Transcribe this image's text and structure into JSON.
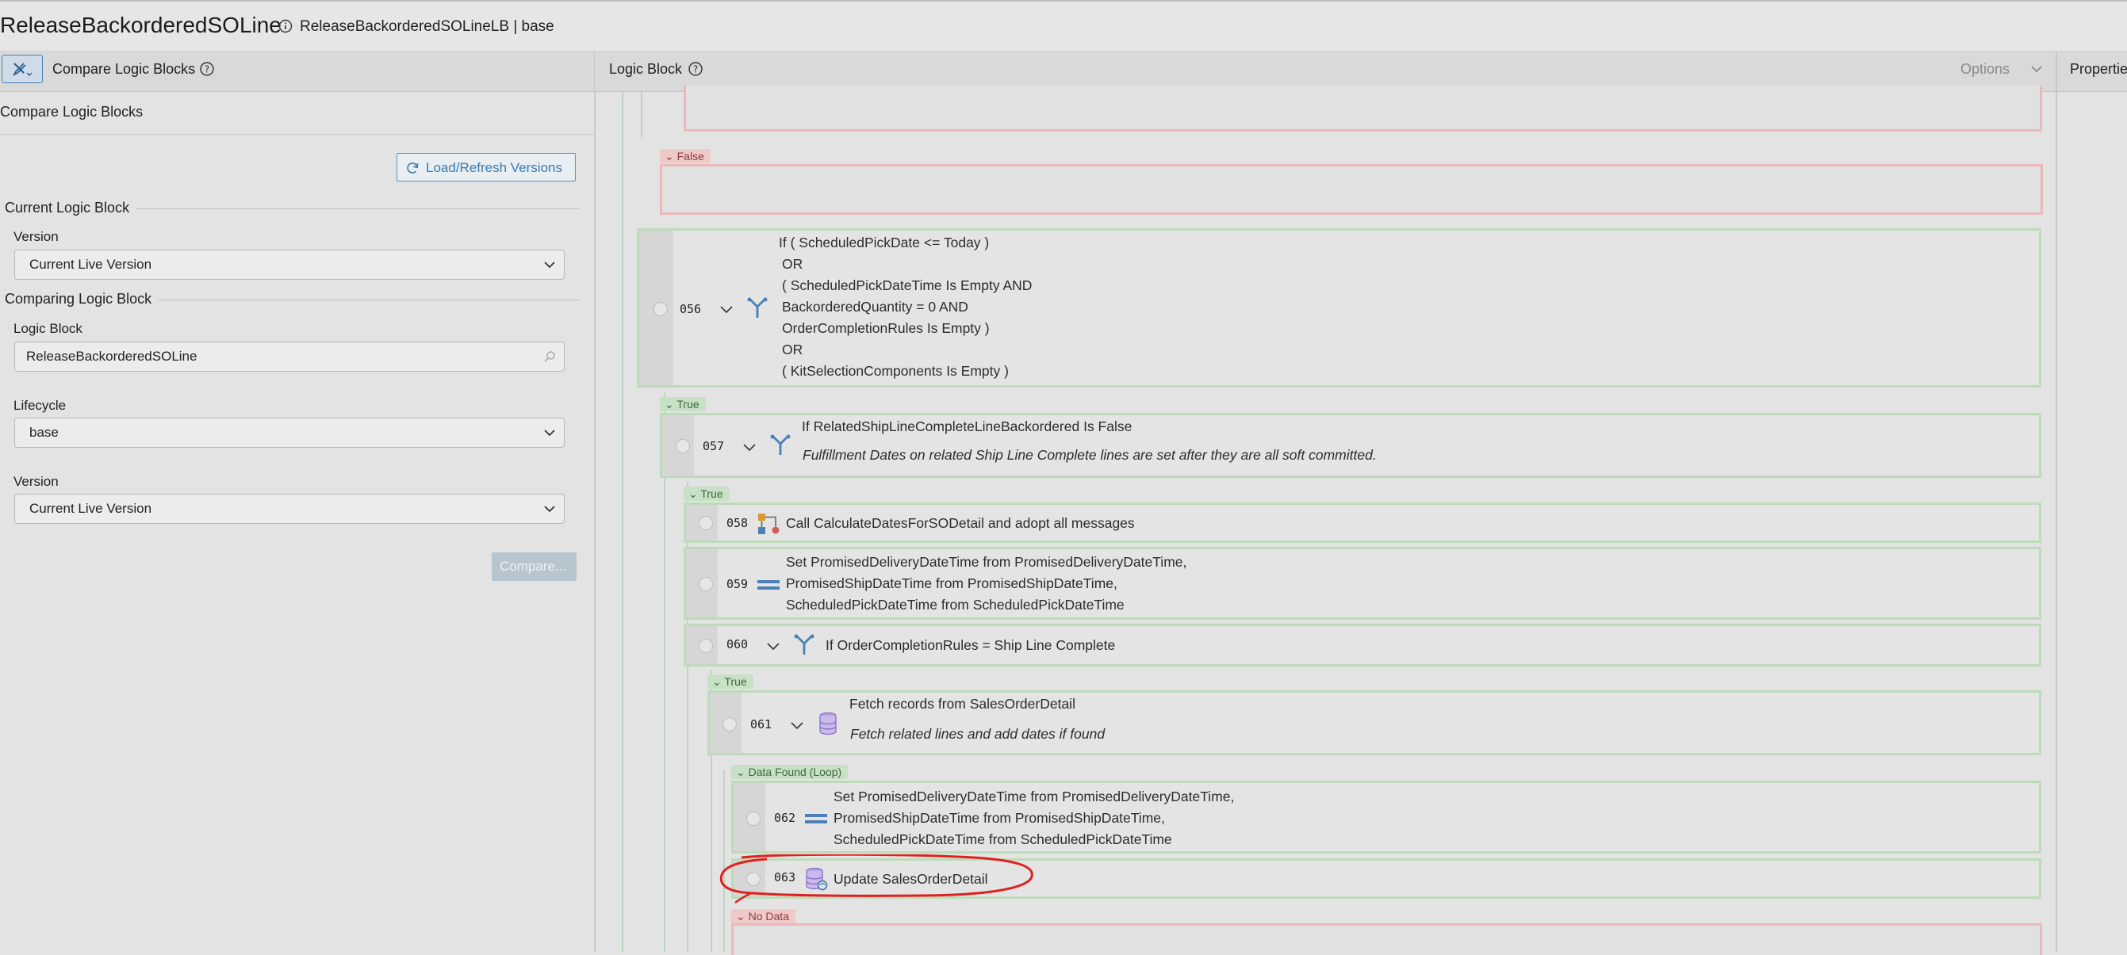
{
  "header": {
    "title": "ReleaseBackorderedSOLine",
    "subtitle": "ReleaseBackorderedSOLineLB | base",
    "info_icon": "info-icon"
  },
  "left_panel": {
    "header_title": "Compare Logic Blocks",
    "tool_icon": "tools-icon",
    "help_icon": "help-icon",
    "section_title": "Compare Logic Blocks",
    "load_button": "Load/Refresh Versions",
    "current_legend": "Current Logic Block",
    "current_version_label": "Version",
    "current_version_value": "Current Live Version",
    "comparing_legend": "Comparing Logic Block",
    "logic_block_label": "Logic Block",
    "logic_block_value": "ReleaseBackorderedSOLine",
    "lifecycle_label": "Lifecycle",
    "lifecycle_value": "base",
    "compare_version_label": "Version",
    "compare_version_value": "Current Live Version",
    "compare_button": "Compare..."
  },
  "middle_panel": {
    "title": "Logic Block",
    "options_label": "Options"
  },
  "right_panel": {
    "title": "Properties"
  },
  "flow": {
    "false_tag": "False",
    "true_tag_1": "True",
    "true_tag_2": "True",
    "true_tag_3": "True",
    "data_found_tag": "Data Found (Loop)",
    "no_data_tag": "No Data",
    "steps": [
      {
        "num": "056",
        "icon": "branch-icon",
        "lines": [
          "If ( ScheduledPickDate <= Today )",
          "OR",
          "( ScheduledPickDateTime Is Empty AND",
          "BackorderedQuantity = 0 AND",
          "OrderCompletionRules Is Empty )",
          "OR",
          "( KitSelectionComponents Is Empty )"
        ]
      },
      {
        "num": "057",
        "icon": "branch-icon",
        "lines": [
          "If RelatedShipLineCompleteLineBackordered Is False"
        ],
        "note": "Fulfillment Dates on related Ship Line Complete lines are set after they are all soft committed."
      },
      {
        "num": "058",
        "icon": "call-icon",
        "lines": [
          "Call CalculateDatesForSODetail and adopt all messages"
        ]
      },
      {
        "num": "059",
        "icon": "assign-icon",
        "lines": [
          "Set PromisedDeliveryDateTime from PromisedDeliveryDateTime,",
          "PromisedShipDateTime from PromisedShipDateTime,",
          "ScheduledPickDateTime from ScheduledPickDateTime"
        ]
      },
      {
        "num": "060",
        "icon": "branch-icon",
        "lines": [
          "If OrderCompletionRules = Ship Line Complete"
        ]
      },
      {
        "num": "061",
        "icon": "database-icon",
        "lines": [
          "Fetch records from SalesOrderDetail"
        ],
        "note": "Fetch related lines and add dates if found"
      },
      {
        "num": "062",
        "icon": "assign-icon",
        "lines": [
          "Set PromisedDeliveryDateTime from PromisedDeliveryDateTime,",
          "PromisedShipDateTime from PromisedShipDateTime,",
          "ScheduledPickDateTime from ScheduledPickDateTime"
        ]
      },
      {
        "num": "063",
        "icon": "database-update-icon",
        "lines": [
          "Update SalesOrderDetail"
        ]
      }
    ]
  },
  "colors": {
    "annotation": "#e02020",
    "accent": "#3a7cae",
    "true_border": "#b5d8b3",
    "false_border": "#ebb9b9"
  }
}
